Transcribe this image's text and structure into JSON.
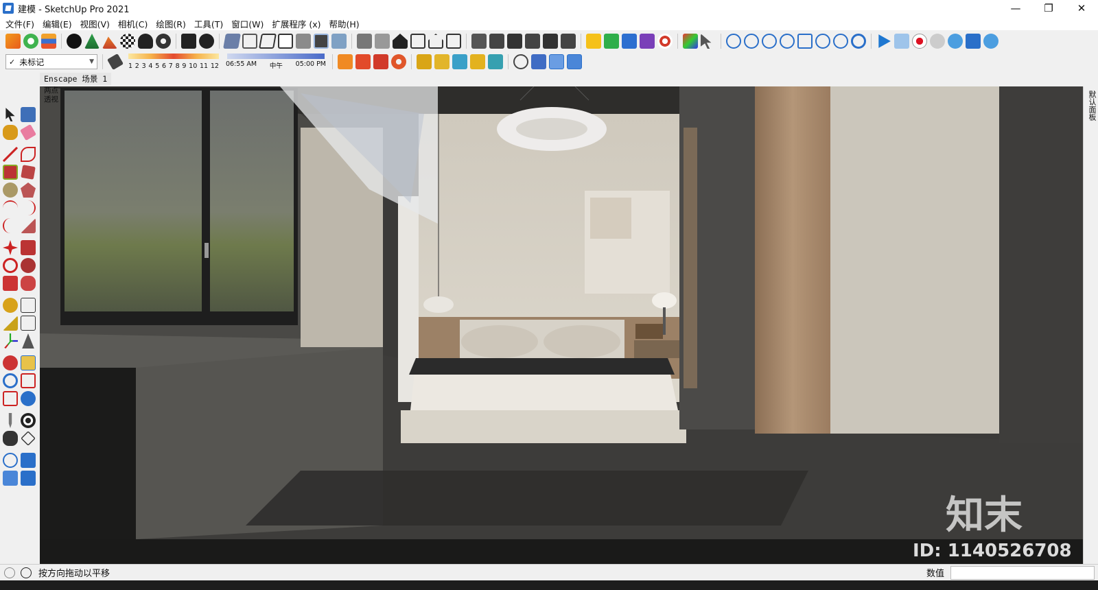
{
  "window": {
    "title": "建模 - SketchUp Pro 2021",
    "minimize": "—",
    "maximize": "❐",
    "close": "✕"
  },
  "menu": [
    "文件(F)",
    "编辑(E)",
    "视图(V)",
    "相机(C)",
    "绘图(R)",
    "工具(T)",
    "窗口(W)",
    "扩展程序 (x)",
    "帮助(H)"
  ],
  "tag": {
    "value": "未标记"
  },
  "shadow": {
    "months": [
      "1",
      "2",
      "3",
      "4",
      "5",
      "6",
      "7",
      "8",
      "9",
      "10",
      "11",
      "12"
    ],
    "times": [
      "06:55 AM",
      "中午",
      "05:00 PM"
    ]
  },
  "scene": {
    "tab": "Enscape 场景 1",
    "view_label": "两点透视"
  },
  "tray": {
    "label": "默认面板"
  },
  "status": {
    "text": "按方向拖动以平移",
    "measure_label": "数值",
    "measure_value": ""
  },
  "watermark": {
    "brand": "知末",
    "id": "ID: 1140526708"
  },
  "colors": {
    "accent": "#2a6fc9",
    "viewport_floor": "#3b3a38",
    "wall": "#d6d1c6",
    "wood": "#a88a6d"
  }
}
